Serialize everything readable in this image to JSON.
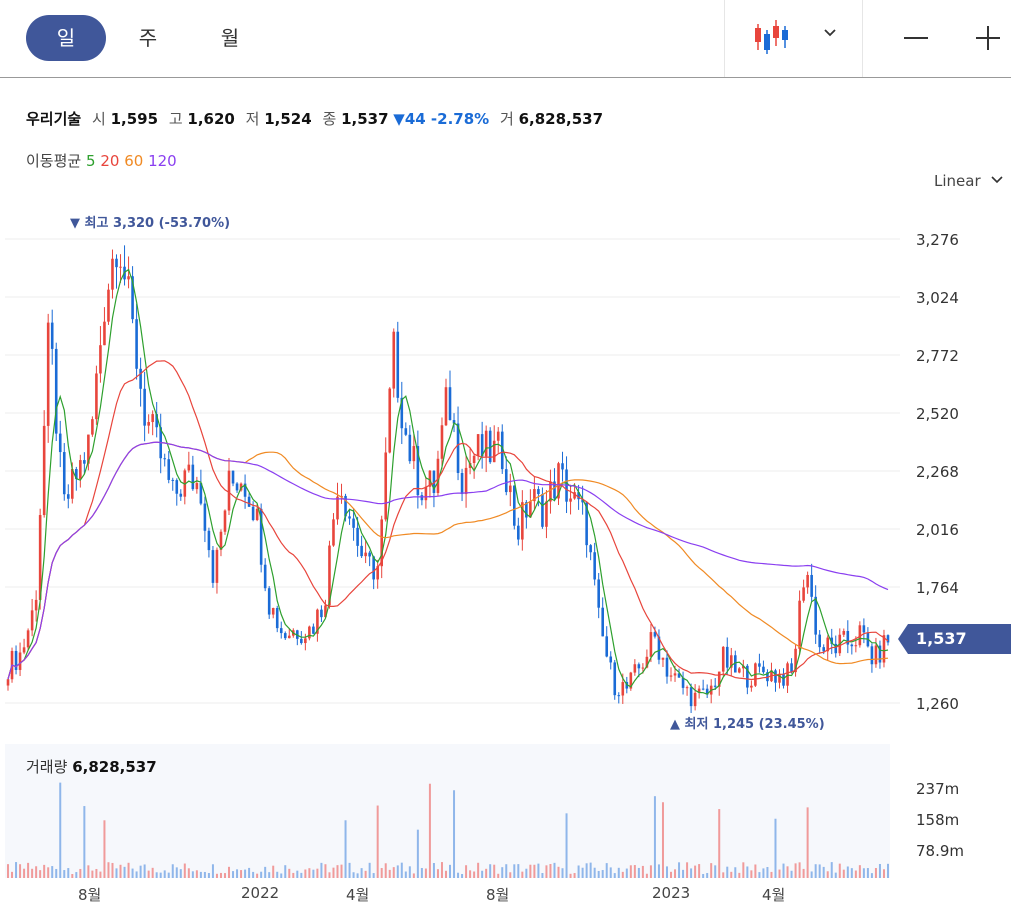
{
  "tabs": [
    "일",
    "주",
    "월"
  ],
  "toolbar": {
    "chart_type_icon": "candlestick-icon",
    "dropdown_icon": "chevron-down-icon",
    "zoom_out_icon": "minus-icon",
    "zoom_in_icon": "plus-icon"
  },
  "stock": {
    "name": "우리기술",
    "open_label": "시",
    "open": "1,595",
    "high_label": "고",
    "high": "1,620",
    "low_label": "저",
    "low": "1,524",
    "close_label": "종",
    "close": "1,537",
    "change": "▼44 -2.78%",
    "volume_label": "거",
    "volume": "6,828,537"
  },
  "moving_average": {
    "label": "이동평균",
    "periods": [
      "5",
      "20",
      "60",
      "120"
    ],
    "colors": [
      "#2ea02e",
      "#e8453c",
      "#f08a24",
      "#8a3ff0"
    ]
  },
  "scale": {
    "label": "Linear"
  },
  "price_tag": "1,537",
  "markers": {
    "max": "▼ 최고 3,320 (-53.70%)",
    "min": "▲ 최저 1,245 (23.45%)"
  },
  "volume_panel": {
    "label": "거래량",
    "value": "6,828,537"
  },
  "colors": {
    "accent": "#40579a",
    "up": "#e8453c",
    "down": "#1a6bd6"
  },
  "chart_data": {
    "type": "candlestick",
    "y_ticks": [
      "3,276",
      "3,024",
      "2,772",
      "2,520",
      "2,268",
      "2,016",
      "1,764",
      "1,260"
    ],
    "y_range": [
      1240,
      3330
    ],
    "x_ticks": [
      "8월",
      "2022",
      "4월",
      "8월",
      "2023",
      "4월"
    ],
    "volume_ticks": [
      "237m",
      "158m",
      "78.9m"
    ],
    "price_path": [
      1420,
      1480,
      1700,
      2900,
      2100,
      2250,
      2400,
      3000,
      3320,
      2900,
      2500,
      2350,
      2150,
      2250,
      2200,
      1800,
      2200,
      2250,
      2100,
      1700,
      1560,
      1580,
      1580,
      1700,
      2250,
      2050,
      1850,
      1850,
      2800,
      2400,
      2200,
      2200,
      2600,
      2250,
      2350,
      2350,
      2350,
      2000,
      2150,
      2100,
      2250,
      2150,
      2050,
      1600,
      1350,
      1320,
      1420,
      1550,
      1400,
      1330,
      1280,
      1300,
      1450,
      1390,
      1380,
      1400,
      1380,
      1380,
      1880,
      1500,
      1500,
      1520,
      1560,
      1440,
      1540
    ]
  }
}
